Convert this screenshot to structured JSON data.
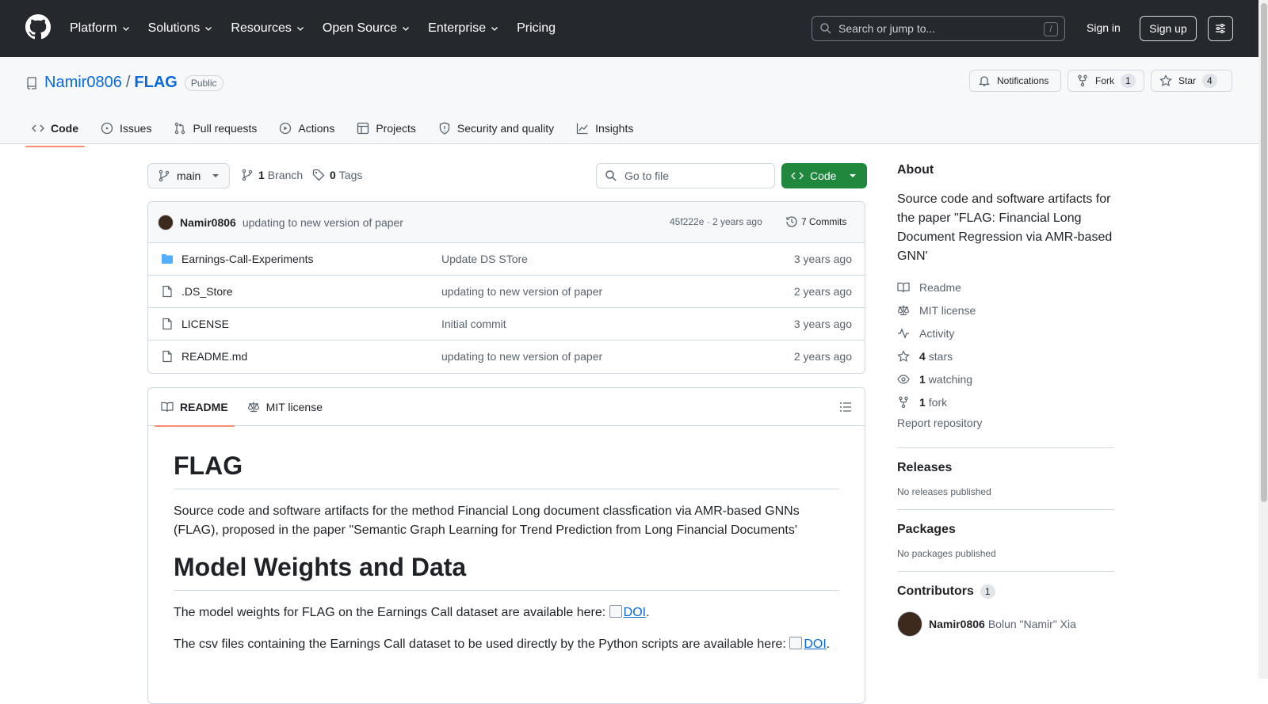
{
  "topnav": {
    "items": [
      {
        "label": "Platform",
        "has_menu": true
      },
      {
        "label": "Solutions",
        "has_menu": true
      },
      {
        "label": "Resources",
        "has_menu": true
      },
      {
        "label": "Open Source",
        "has_menu": true
      },
      {
        "label": "Enterprise",
        "has_menu": true
      },
      {
        "label": "Pricing",
        "has_menu": false
      }
    ],
    "search_placeholder": "Search or jump to...",
    "search_shortcut": "/",
    "signin": "Sign in",
    "signup": "Sign up"
  },
  "repo": {
    "owner": "Namir0806",
    "separator": "/",
    "name": "FLAG",
    "visibility": "Public",
    "notifications_label": "Notifications",
    "fork_label": "Fork",
    "fork_count": "1",
    "star_label": "Star",
    "star_count": "4"
  },
  "tabs": [
    {
      "label": "Code",
      "icon": "code-icon",
      "active": true
    },
    {
      "label": "Issues",
      "icon": "issue-icon"
    },
    {
      "label": "Pull requests",
      "icon": "pull-request-icon"
    },
    {
      "label": "Actions",
      "icon": "play-icon"
    },
    {
      "label": "Projects",
      "icon": "table-icon"
    },
    {
      "label": "Security and quality",
      "icon": "shield-icon"
    },
    {
      "label": "Insights",
      "icon": "graph-icon"
    }
  ],
  "branch": {
    "name": "main",
    "branch_count": "1",
    "branch_label": "Branch",
    "tag_count": "0",
    "tag_label": "Tags",
    "goto_placeholder": "Go to file",
    "code_label": "Code"
  },
  "commit": {
    "author": "Namir0806",
    "message": "updating to new version of paper",
    "hash_time": "45f222e · 2 years ago",
    "commits_label": "7 Commits"
  },
  "files": [
    {
      "name": "Earnings-Call-Experiments",
      "type": "folder",
      "message": "Update DS STore",
      "date": "3 years ago"
    },
    {
      "name": ".DS_Store",
      "type": "file",
      "message": "updating to new version of paper",
      "date": "2 years ago"
    },
    {
      "name": "LICENSE",
      "type": "file",
      "message": "Initial commit",
      "date": "3 years ago"
    },
    {
      "name": "README.md",
      "type": "file",
      "message": "updating to new version of paper",
      "date": "2 years ago"
    }
  ],
  "readme": {
    "tab_readme": "README",
    "tab_license": "MIT license",
    "h1": "FLAG",
    "p1": "Source code and software artifacts for the method Financial Long document classfication via AMR-based GNNs (FLAG), proposed in the paper \"Semantic Graph Learning for Trend Prediction from Long Financial Documents'",
    "h2": "Model Weights and Data",
    "p2_text": "The model weights for FLAG on the Earnings Call dataset are available here: ",
    "p3_text": "The csv files containing the Earnings Call dataset to be used directly by the Python scripts are available here: ",
    "doi": "DOI",
    "period": "."
  },
  "about": {
    "title": "About",
    "description": "Source code and software artifacts for the paper \"FLAG: Financial Long Document Regression via AMR-based GNN'",
    "readme": "Readme",
    "license": "MIT license",
    "activity": "Activity",
    "stars_count": "4",
    "stars_label": "stars",
    "watching_count": "1",
    "watching_label": "watching",
    "fork_count": "1",
    "fork_label": "fork",
    "report": "Report repository"
  },
  "releases": {
    "title": "Releases",
    "text": "No releases published"
  },
  "packages": {
    "title": "Packages",
    "text": "No packages published"
  },
  "contributors": {
    "title": "Contributors",
    "count": "1",
    "login": "Namir0806",
    "fullname": "Bolun \"Namir\" Xia"
  }
}
